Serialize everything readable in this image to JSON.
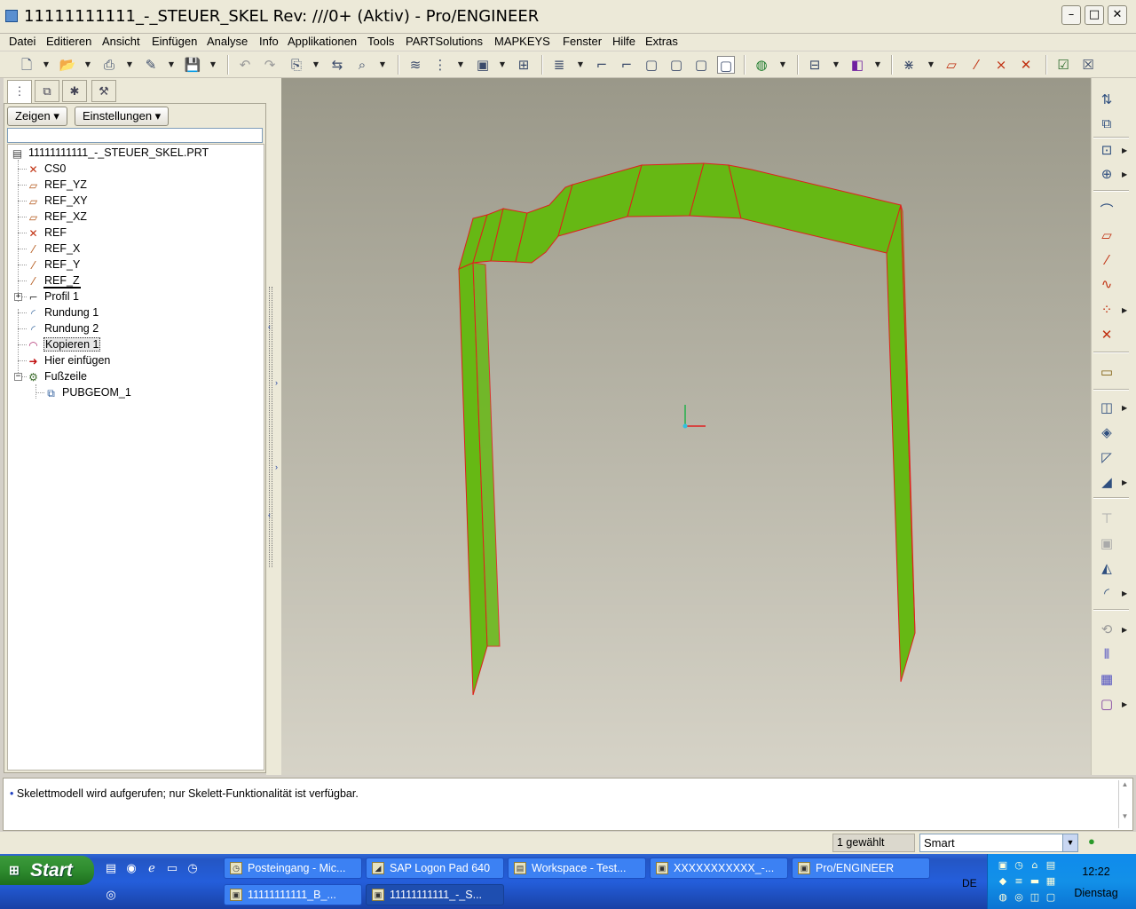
{
  "window": {
    "title": "11111111111_-_STEUER_SKEL Rev: ///0+ (Aktiv) - Pro/ENGINEER",
    "minimize": "–",
    "maximize": "□",
    "close": "✕"
  },
  "menu": [
    "Datei",
    "Editieren",
    "Ansicht",
    "Einfügen",
    "Analyse",
    "Info",
    "Applikationen",
    "Tools",
    "PARTSolutions",
    "MAPKEYS",
    "Fenster",
    "Hilfe",
    "Extras"
  ],
  "panel": {
    "show_button": "Zeigen",
    "settings_button": "Einstellungen",
    "tree": [
      {
        "label": "11111111111_-_STEUER_SKEL.PRT",
        "icon": "part-icon"
      },
      {
        "label": "CS0",
        "icon": "csys-icon"
      },
      {
        "label": "REF_YZ",
        "icon": "datum-plane-icon"
      },
      {
        "label": "REF_XY",
        "icon": "datum-plane-icon"
      },
      {
        "label": "REF_XZ",
        "icon": "datum-plane-icon"
      },
      {
        "label": "REF",
        "icon": "csys-icon"
      },
      {
        "label": "REF_X",
        "icon": "datum-axis-icon"
      },
      {
        "label": "REF_Y",
        "icon": "datum-axis-icon"
      },
      {
        "label": "REF_Z",
        "icon": "datum-axis-icon"
      },
      {
        "label": "Profil 1",
        "icon": "profile-icon"
      },
      {
        "label": "Rundung 1",
        "icon": "round-icon"
      },
      {
        "label": "Rundung 2",
        "icon": "round-icon"
      },
      {
        "label": "Kopieren 1",
        "icon": "copy-geom-icon"
      },
      {
        "label": "Hier einfügen",
        "icon": "insert-here-arrow-icon"
      },
      {
        "label": "Fußzeile",
        "icon": "footer-icon"
      },
      {
        "label": "PUBGEOM_1",
        "icon": "pubgeom-icon"
      }
    ]
  },
  "message": "Skelettmodell wird aufgerufen; nur Skelett-Funktionalität ist verfügbar.",
  "status": {
    "selected": "1 gewählt",
    "filter": "Smart"
  },
  "taskbar": {
    "start": "Start",
    "tasks_row1": [
      "Posteingang - Mic...",
      "SAP Logon Pad 640",
      "Workspace - Test...",
      "XXXXXXXXXXX_-...",
      "Pro/ENGINEER"
    ],
    "tasks_row2": [
      "11111111111_B_...",
      "11111111111_-_S..."
    ],
    "lang": "DE",
    "time": "12:22",
    "day": "Dienstag"
  },
  "colors": {
    "model_fill": "#66b814",
    "model_edge": "#e0201c",
    "viewport_top": "#9a9889",
    "viewport_bottom": "#d6d3c7"
  }
}
